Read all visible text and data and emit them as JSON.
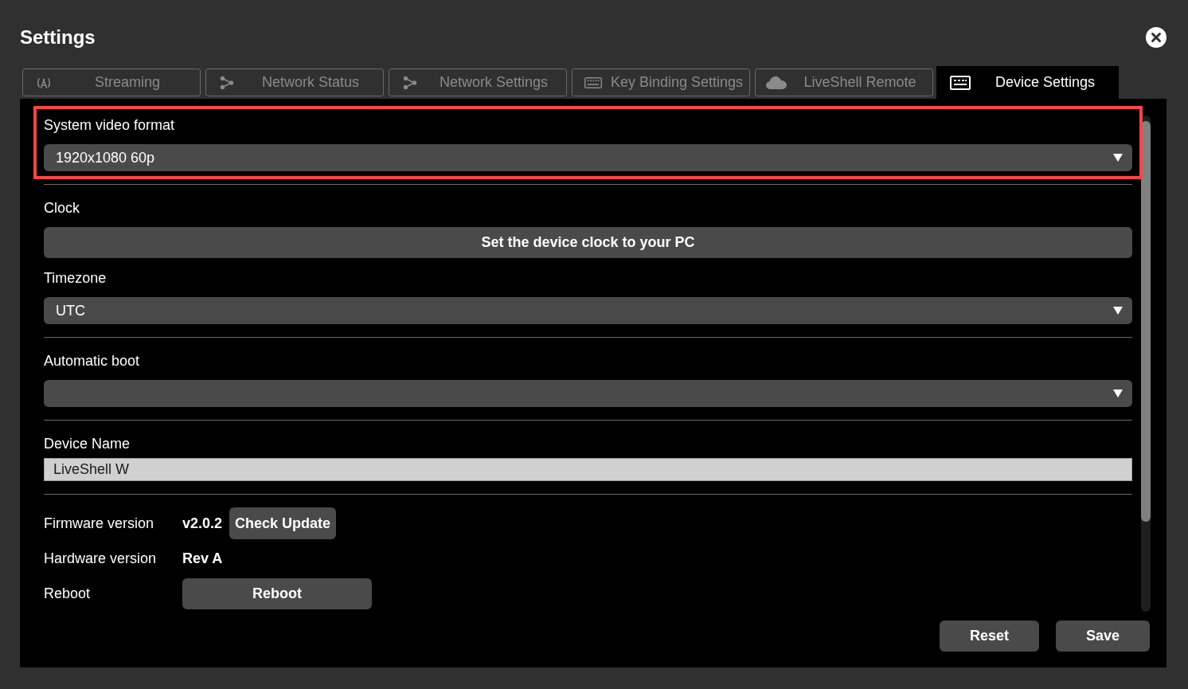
{
  "window": {
    "title": "Settings"
  },
  "tabs": [
    {
      "label": "Streaming",
      "kind": "broadcast",
      "selected": false
    },
    {
      "label": "Network Status",
      "kind": "share",
      "selected": false
    },
    {
      "label": "Network Settings",
      "kind": "share",
      "selected": false
    },
    {
      "label": "Key Binding Settings",
      "kind": "keyboard",
      "selected": false
    },
    {
      "label": "LiveShell Remote",
      "kind": "cloud",
      "selected": false
    },
    {
      "label": "Device Settings",
      "kind": "keyboard",
      "selected": true
    }
  ],
  "sections": [
    {
      "highlighted": true,
      "fields": [
        {
          "kind": "select",
          "label": "System video format",
          "value": "1920x1080 60p"
        }
      ]
    },
    {
      "highlighted": false,
      "fields": [
        {
          "kind": "button",
          "label": "Clock",
          "button": "Set the device clock to your PC"
        },
        {
          "kind": "select",
          "label": "Timezone",
          "value": "UTC"
        }
      ]
    },
    {
      "highlighted": false,
      "fields": [
        {
          "kind": "select",
          "label": "Automatic boot"
        }
      ]
    },
    {
      "highlighted": false,
      "fields": [
        {
          "kind": "text",
          "label": "Device Name",
          "value": "LiveShell W"
        }
      ]
    }
  ],
  "info_rows": [
    {
      "label": "Firmware version",
      "value": "v2.0.2",
      "button": "Check Update"
    },
    {
      "label": "Hardware version",
      "value": "Rev A"
    },
    {
      "label": "Reboot",
      "button": "Reboot"
    }
  ],
  "footer_buttons": [
    "Reset",
    "Save"
  ]
}
